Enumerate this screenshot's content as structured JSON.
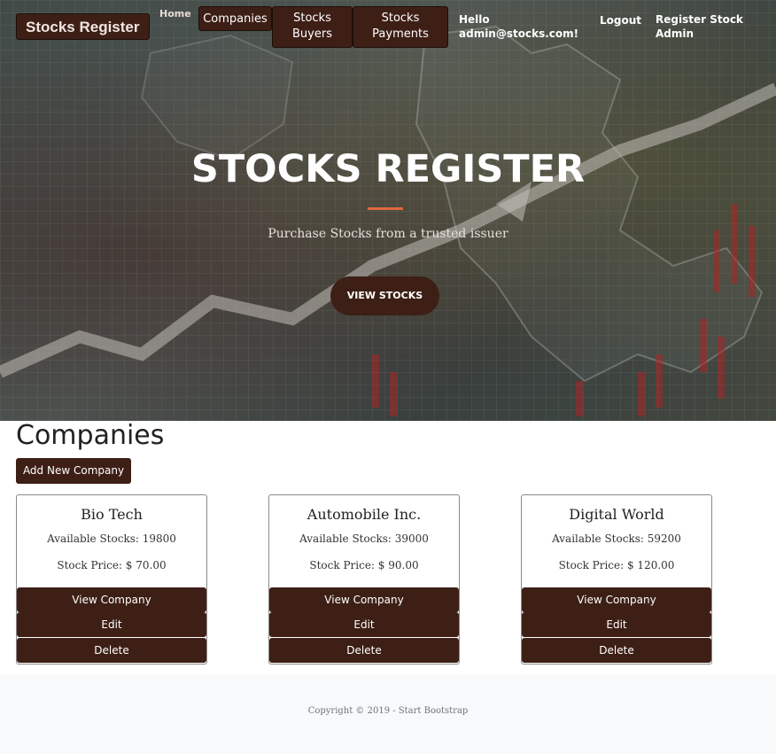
{
  "nav": {
    "brand": "Stocks Register",
    "home": "Home",
    "companies": "Companies",
    "stocks_buyers_1": "Stocks",
    "stocks_buyers_2": "Buyers",
    "stocks_payments_1": "Stocks",
    "stocks_payments_2": "Payments",
    "hello_1": "Hello",
    "hello_2": "admin@stocks.com!",
    "logout": "Logout",
    "register_1": "Register Stock",
    "register_2": "Admin"
  },
  "hero": {
    "title": "STOCKS REGISTER",
    "subtitle": "Purchase Stocks from a trusted issuer",
    "button": "VIEW STOCKS"
  },
  "companies": {
    "title": "Companies",
    "add_button": "Add New Company",
    "cards": [
      {
        "name": "Bio Tech",
        "available": "Available Stocks: 19800",
        "price": "Stock Price: $ 70.00",
        "view": "View Company",
        "edit": "Edit",
        "delete": "Delete"
      },
      {
        "name": "Automobile Inc.",
        "available": "Available Stocks: 39000",
        "price": "Stock Price: $ 90.00",
        "view": "View Company",
        "edit": "Edit",
        "delete": "Delete"
      },
      {
        "name": "Digital World",
        "available": "Available Stocks: 59200",
        "price": "Stock Price: $ 120.00",
        "view": "View Company",
        "edit": "Edit",
        "delete": "Delete"
      }
    ]
  },
  "footer": {
    "copyright": "Copyright © 2019 - Start Bootstrap"
  },
  "colors": {
    "primary": "#3d1f16",
    "accent": "#e0683f",
    "footer_bg": "#f8f9fa"
  }
}
